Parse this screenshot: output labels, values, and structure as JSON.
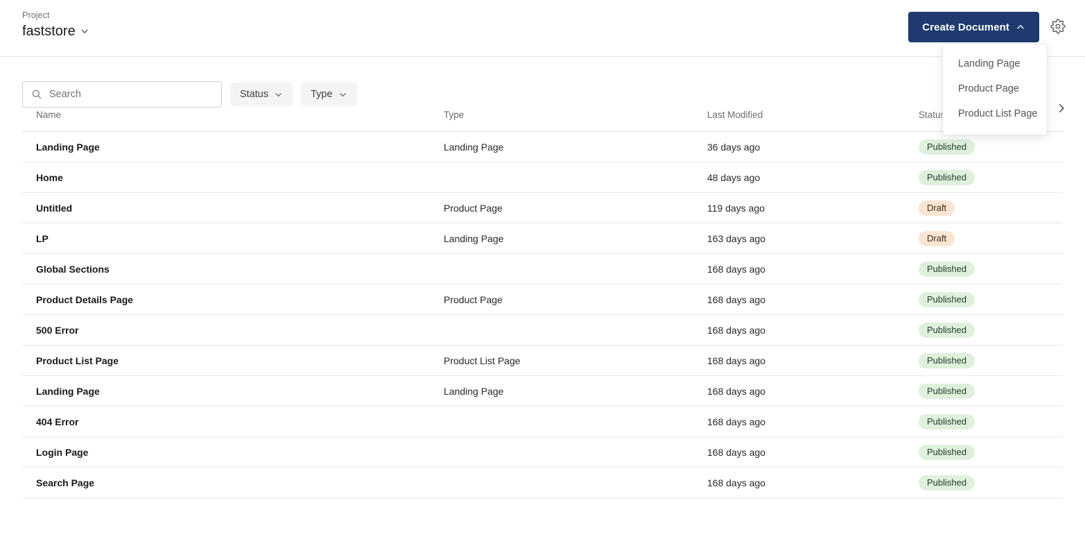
{
  "header": {
    "project_label": "Project",
    "project_name": "faststore",
    "project_caret_icon": "chevron-down-icon",
    "create_button_label": "Create Document",
    "create_button_icon": "chevron-up-icon",
    "create_button_color": "#1e3a6e",
    "settings_icon": "gear-icon"
  },
  "create_menu": {
    "open": true,
    "items": [
      {
        "label": "Landing Page"
      },
      {
        "label": "Product Page"
      },
      {
        "label": "Product List Page"
      }
    ]
  },
  "toolbar": {
    "search": {
      "icon": "search-icon",
      "placeholder": "Search",
      "value": ""
    },
    "filters": [
      {
        "label": "Status",
        "icon": "chevron-down-icon"
      },
      {
        "label": "Type",
        "icon": "chevron-down-icon"
      }
    ]
  },
  "table": {
    "columns": [
      "Name",
      "Type",
      "Last Modified",
      "Status"
    ],
    "rows": [
      {
        "name": "Landing Page",
        "type": "Landing Page",
        "modified": "36 days ago",
        "status": "Published"
      },
      {
        "name": "Home",
        "type": "",
        "modified": "48 days ago",
        "status": "Published"
      },
      {
        "name": "Untitled",
        "type": "Product Page",
        "modified": "119 days ago",
        "status": "Draft"
      },
      {
        "name": "LP",
        "type": "Landing Page",
        "modified": "163 days ago",
        "status": "Draft"
      },
      {
        "name": "Global Sections",
        "type": "",
        "modified": "168 days ago",
        "status": "Published"
      },
      {
        "name": "Product Details Page",
        "type": "Product Page",
        "modified": "168 days ago",
        "status": "Published"
      },
      {
        "name": "500 Error",
        "type": "",
        "modified": "168 days ago",
        "status": "Published"
      },
      {
        "name": "Product List Page",
        "type": "Product List Page",
        "modified": "168 days ago",
        "status": "Published"
      },
      {
        "name": "Landing Page",
        "type": "Landing Page",
        "modified": "168 days ago",
        "status": "Published"
      },
      {
        "name": "404 Error",
        "type": "",
        "modified": "168 days ago",
        "status": "Published"
      },
      {
        "name": "Login Page",
        "type": "",
        "modified": "168 days ago",
        "status": "Published"
      },
      {
        "name": "Search Page",
        "type": "",
        "modified": "168 days ago",
        "status": "Published"
      }
    ]
  },
  "scroll_next": {
    "icon": "chevron-right-icon"
  },
  "colors": {
    "brand_navy": "#1e3a6e",
    "badge_published_bg": "#dff0dd",
    "badge_draft_bg": "#fae5d2",
    "border": "#e4e4e7"
  }
}
